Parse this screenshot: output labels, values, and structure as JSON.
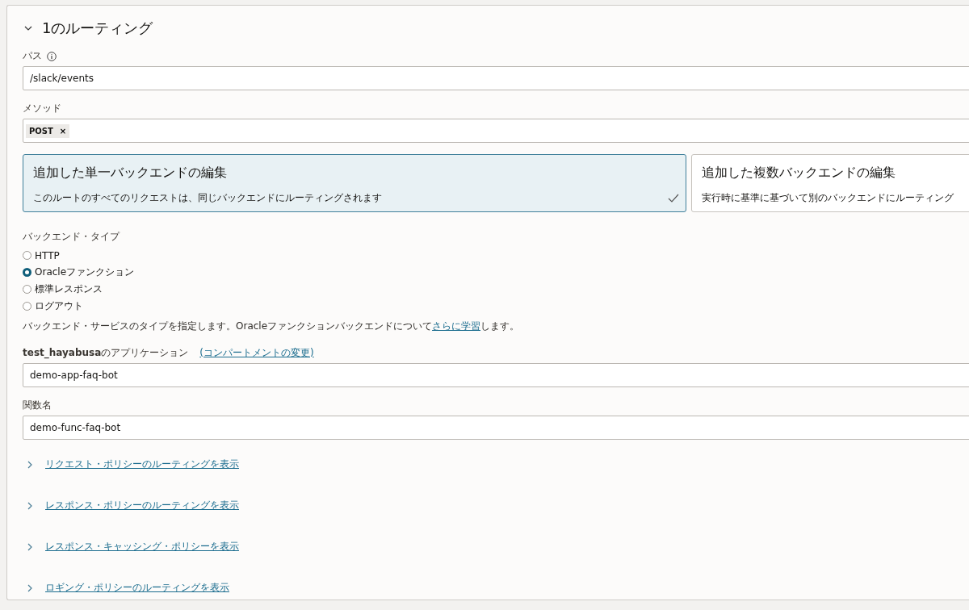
{
  "section": {
    "title": "1のルーティング",
    "expanded": true
  },
  "path": {
    "label": "パス",
    "value": "/slack/events"
  },
  "method": {
    "label": "メソッド",
    "tags": [
      {
        "label": "POST",
        "remove": "×"
      }
    ]
  },
  "backend_cards": [
    {
      "title": "追加した単一バックエンドの編集",
      "description": "このルートのすべてのリクエストは、同じバックエンドにルーティングされます",
      "selected": true
    },
    {
      "title": "追加した複数バックエンドの編集",
      "description": "実行時に基準に基づいて別のバックエンドにルーティング",
      "selected": false
    }
  ],
  "backend_type": {
    "label": "バックエンド・タイプ",
    "options": [
      {
        "label": "HTTP",
        "selected": false
      },
      {
        "label": "Oracleファンクション",
        "selected": true
      },
      {
        "label": "標準レスポンス",
        "selected": false
      },
      {
        "label": "ログアウト",
        "selected": false
      }
    ],
    "help": {
      "before": "バックエンド・サービスのタイプを指定します。Oracleファンクションバックエンドについて",
      "link": "さらに学習",
      "after": "します。"
    }
  },
  "application": {
    "label": "**test_hayabusa**のアプリケーション",
    "link": "(コンパートメントの変更)",
    "value": "demo-app-faq-bot"
  },
  "function": {
    "label": "関数名",
    "value": "demo-func-faq-bot"
  },
  "policy_links": [
    {
      "label": "リクエスト・ポリシーのルーティングを表示",
      "expanded": false
    },
    {
      "label": "レスポンス・ポリシーのルーティングを表示",
      "expanded": false
    },
    {
      "label": "レスポンス・キャッシング・ポリシーを表示",
      "expanded": false
    },
    {
      "label": "ロギング・ポリシーのルーティングを表示",
      "expanded": false
    }
  ]
}
